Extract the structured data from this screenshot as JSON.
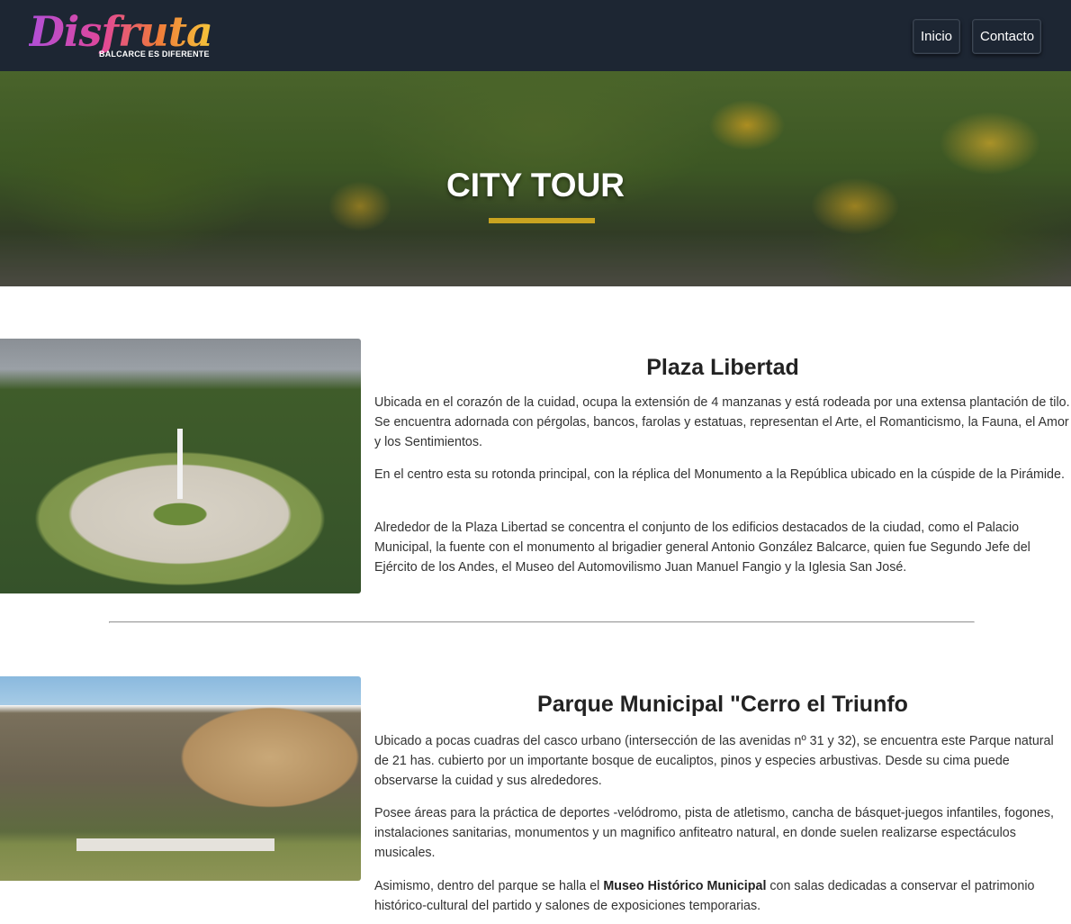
{
  "brand": {
    "logo_script": "Disfruta",
    "logo_tagline": "BALCARCE ES DIFERENTE"
  },
  "nav": {
    "items": [
      {
        "label": "Inicio"
      },
      {
        "label": "Contacto"
      }
    ]
  },
  "hero": {
    "title": "CITY TOUR",
    "accent_color": "#c9a320"
  },
  "sections": [
    {
      "title": "Plaza Libertad",
      "paragraphs": [
        "Ubicada en el corazón de la cuidad, ocupa la extensión de 4 manzanas y está rodeada por una extensa plantación de tilo. Se encuentra adornada con pérgolas, bancos, farolas y estatuas, representan el Arte, el Romanticismo, la Fauna, el Amor y los Sentimientos.",
        "En el centro esta su rotonda principal, con la réplica del Monumento a la República ubicado en la cúspide de la Pirámide.",
        "Alrededor de la Plaza Libertad se concentra el conjunto de los edificios destacados de la ciudad, como el Palacio Municipal, la fuente con el monumento al brigadier general Antonio González Balcarce, quien fue Segundo Jefe del Ejército de los Andes, el Museo del Automovilismo Juan Manuel Fangio y la Iglesia San José."
      ]
    },
    {
      "title": "Parque Municipal \"Cerro el Triunfo",
      "paragraphs": [
        "Ubicado a pocas cuadras del casco urbano (intersección de las avenidas nº 31 y 32), se encuentra este Parque natural de 21 has. cubierto por un importante bosque de eucaliptos, pinos y especies arbustivas. Desde su cima puede observarse la cuidad y sus alrededores.",
        "Posee áreas para la práctica de deportes -velódromo, pista de atletismo, cancha de básquet-juegos infantiles, fogones, instalaciones sanitarias, monumentos y un magnifico anfiteatro natural, en donde suelen realizarse espectáculos musicales."
      ],
      "last_paragraph": {
        "before": "Asimismo, dentro del parque se halla el ",
        "bold": "Museo Histórico Municipal",
        "after": " con salas dedicadas a conservar el patrimonio histórico-cultural del partido y salones de exposiciones temporarias."
      }
    }
  ]
}
